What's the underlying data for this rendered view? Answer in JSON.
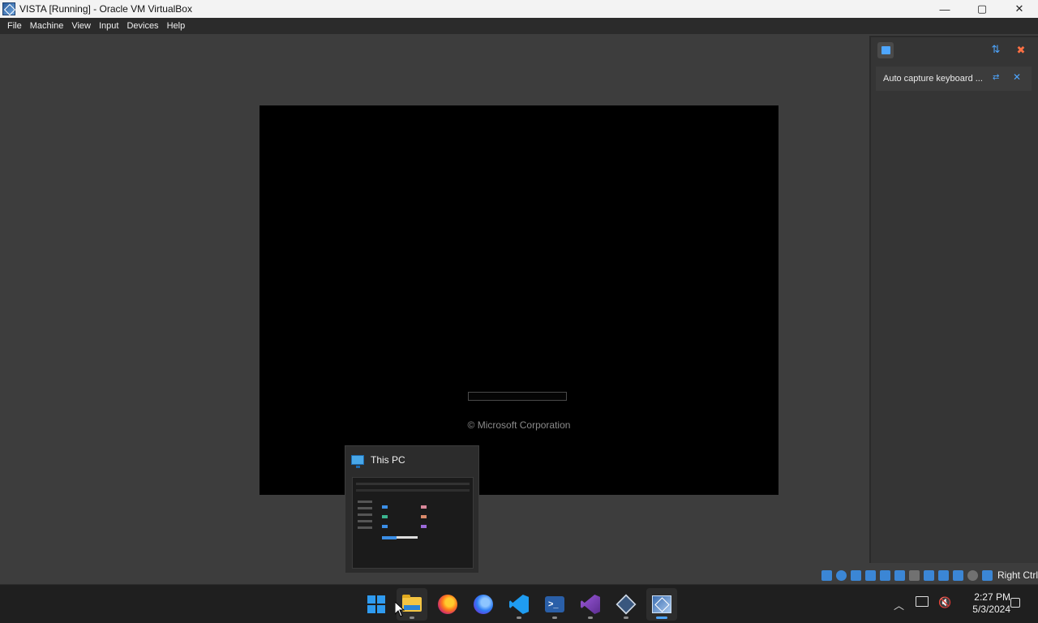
{
  "window": {
    "title": "VISTA [Running] - Oracle VM VirtualBox",
    "controls": {
      "minimize": "—",
      "maximize": "▢",
      "close": "✕"
    }
  },
  "menubar": {
    "items": [
      "File",
      "Machine",
      "View",
      "Input",
      "Devices",
      "Help"
    ]
  },
  "vm": {
    "copyright": "© Microsoft Corporation"
  },
  "side_panel": {
    "notification": "Auto capture keyboard ..."
  },
  "statusbar": {
    "host_key": "Right Ctrl"
  },
  "preview": {
    "title": "This PC"
  },
  "taskbar": {
    "apps": [
      "Start",
      "File Explorer",
      "Firefox",
      "Firefox Developer Edition",
      "Visual Studio Code",
      "PowerShell",
      "Visual Studio",
      "VirtualBox",
      "VISTA - Oracle VM VirtualBox"
    ],
    "clock_time": "2:27 PM",
    "clock_date": "5/3/2024"
  },
  "colors": {
    "accent": "#4ea6ff",
    "taskbar": "#1f1f1f",
    "vm_background": "#000000",
    "app_background": "#3d3d3d"
  }
}
